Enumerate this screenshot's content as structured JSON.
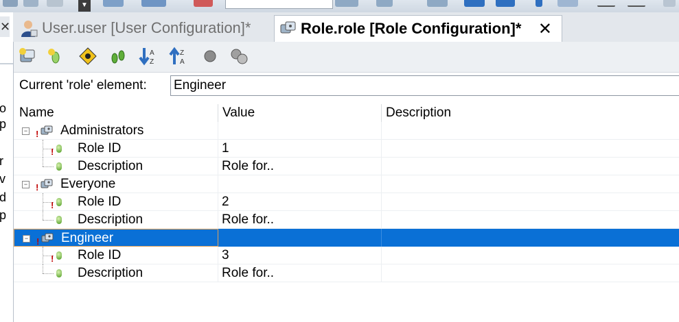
{
  "tabs": [
    {
      "label": "User.user [User Configuration]*",
      "active": false
    },
    {
      "label": "Role.role [Role Configuration]*",
      "active": true
    }
  ],
  "toolbar_icons": [
    "add-role-icon",
    "add-item-icon",
    "validate-icon",
    "expand-icon",
    "sort-ascending-icon",
    "sort-descending-icon",
    "circle-icon",
    "gears-icon"
  ],
  "current_element": {
    "label": "Current 'role' element:",
    "value": "Engineer"
  },
  "grid": {
    "columns": [
      "Name",
      "Value",
      "Description"
    ],
    "roles": [
      {
        "name": "Administrators",
        "children": [
          {
            "name": "Role ID",
            "value": "1"
          },
          {
            "name": "Description",
            "value": "Role for.."
          }
        ]
      },
      {
        "name": "Everyone",
        "children": [
          {
            "name": "Role ID",
            "value": "2"
          },
          {
            "name": "Description",
            "value": "Role for.."
          }
        ]
      },
      {
        "name": "Engineer",
        "selected": true,
        "children": [
          {
            "name": "Role ID",
            "value": "3"
          },
          {
            "name": "Description",
            "value": "Role for.."
          }
        ]
      }
    ]
  },
  "left_panel_fragments": [
    "o",
    "p",
    "r",
    "v",
    "d",
    "p"
  ],
  "colors": {
    "selection": "#0a70d6",
    "required_marker": "#c00000",
    "toolbar_bg": "#edf0f3"
  }
}
